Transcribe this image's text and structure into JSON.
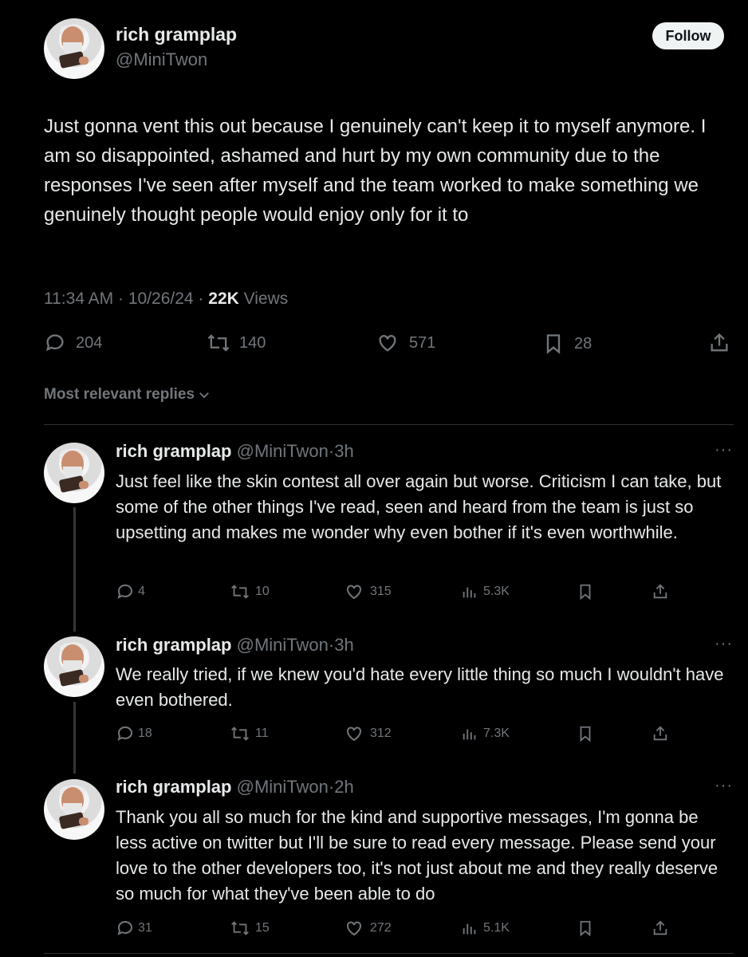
{
  "main_post": {
    "display_name": "rich gramplap",
    "handle": "@MiniTwon",
    "follow_label": "Follow",
    "text": "Just gonna vent this out because I genuinely can't keep it to myself anymore. I am so disappointed, ashamed and hurt by my own community due to the responses I've seen after myself and the team worked to make something we genuinely thought people would enjoy only for it to",
    "time": "11:34 AM",
    "date": "10/26/24",
    "views_count": "22K",
    "views_label": "Views",
    "stats": {
      "replies": "204",
      "reposts": "140",
      "likes": "571",
      "bookmarks": "28"
    }
  },
  "replies_header": "Most relevant replies",
  "replies": [
    {
      "display_name": "rich gramplap",
      "handle": "@MiniTwon",
      "time": "3h",
      "text": "Just feel like the skin contest all over again but worse. Criticism I can take, but some of the other things I've read, seen and heard from the team is just so upsetting and makes me wonder why even bother if it's even worthwhile.",
      "replies": "4",
      "reposts": "10",
      "likes": "315",
      "views": "5.3K"
    },
    {
      "display_name": "rich gramplap",
      "handle": "@MiniTwon",
      "time": "3h",
      "text": "We really tried, if we knew you'd hate every little thing so much I wouldn't have even bothered.",
      "replies": "18",
      "reposts": "11",
      "likes": "312",
      "views": "7.3K"
    },
    {
      "display_name": "rich gramplap",
      "handle": "@MiniTwon",
      "time": "2h",
      "text": "Thank you all so much for the kind and supportive messages, I'm gonna be less active on twitter but I'll be sure to read every message. Please send your love to the other developers too, it's not just about me and they really deserve so much for what they've been able to do",
      "replies": "31",
      "reposts": "15",
      "likes": "272",
      "views": "5.1K"
    }
  ],
  "icons": {
    "more": "more-icon",
    "reply": "reply-icon",
    "repost": "repost-icon",
    "like": "heart-icon",
    "bookmark": "bookmark-icon",
    "share": "share-icon",
    "views": "views-icon"
  },
  "colors": {
    "background": "#000000",
    "text": "#e7e9ea",
    "muted": "#71767b",
    "follow_bg": "#eff3f4"
  }
}
